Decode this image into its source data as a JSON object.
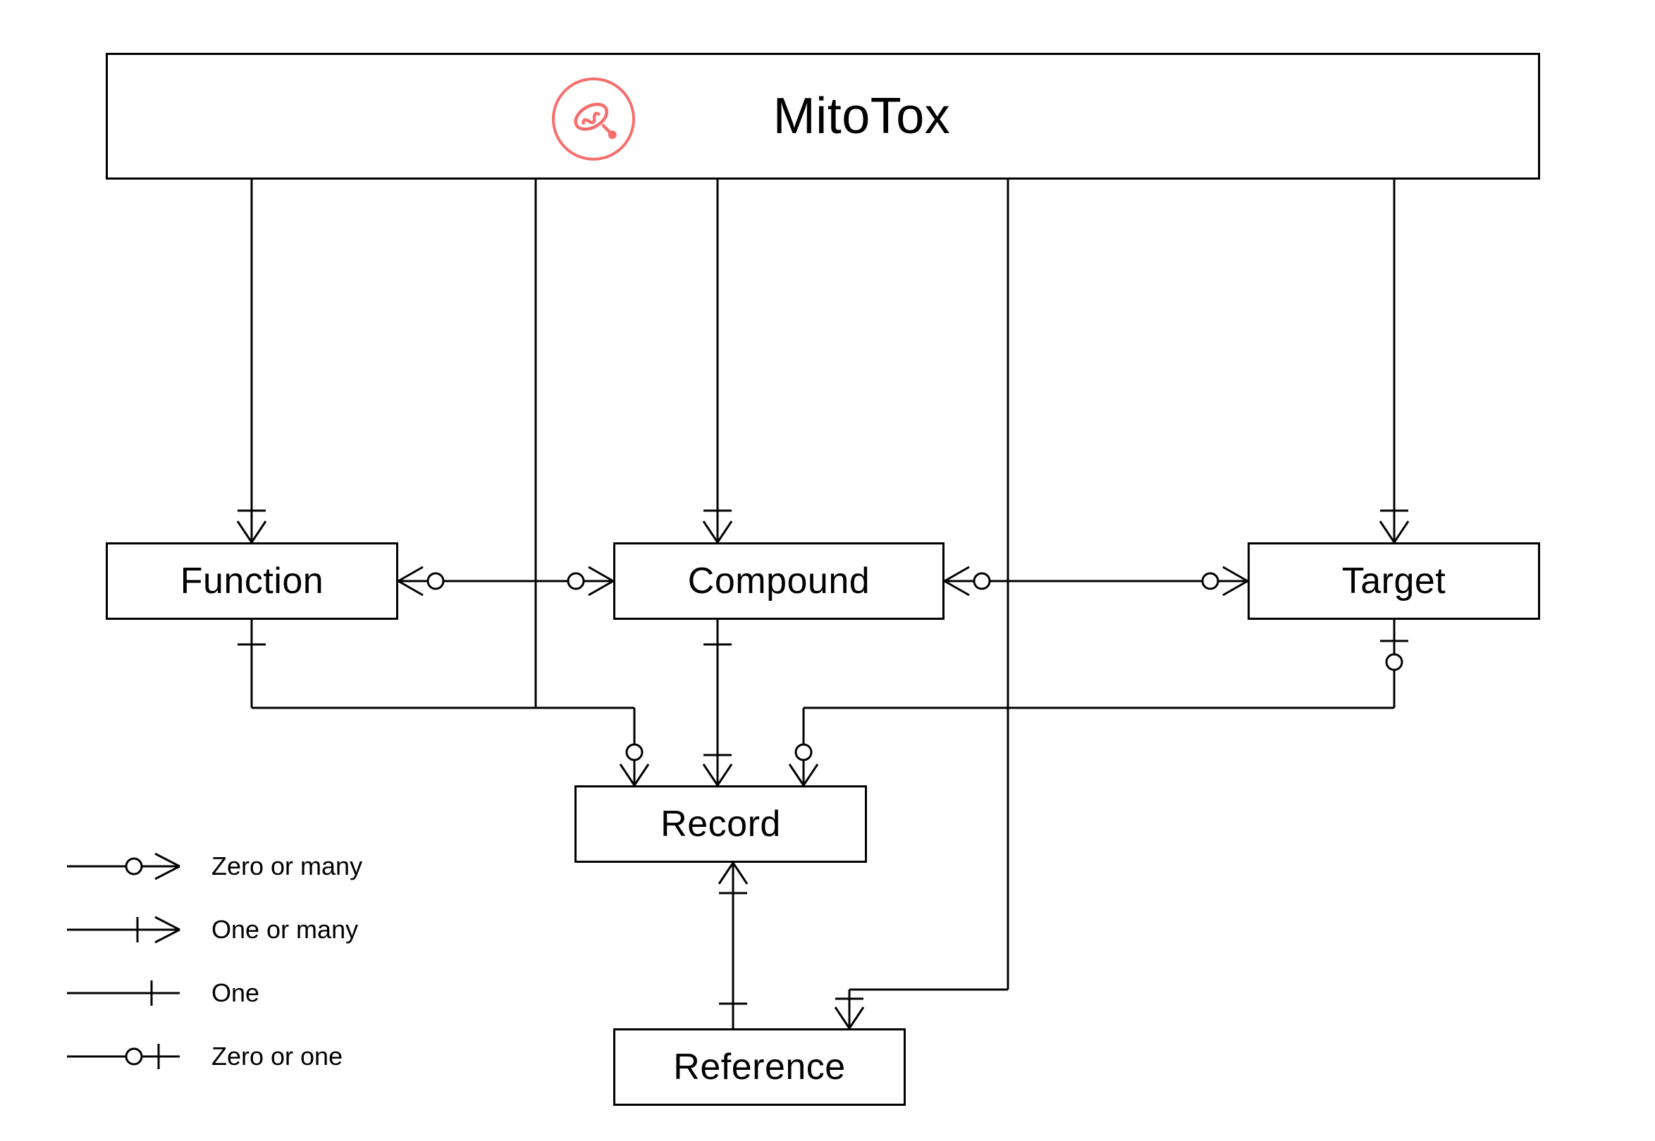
{
  "diagram": {
    "title": "MitoTox",
    "logo_name": "mitochondrion-icon",
    "accent_color": "#f76e6e",
    "entities": {
      "function": "Function",
      "compound": "Compound",
      "target": "Target",
      "record": "Record",
      "reference": "Reference"
    },
    "legend": {
      "zero_or_many": "Zero or many",
      "one_or_many": "One or many",
      "one": "One",
      "zero_or_one": "Zero or one"
    },
    "relationships": [
      {
        "from": "MitoTox",
        "to": "Function",
        "to_card": "one_or_many"
      },
      {
        "from": "MitoTox",
        "to": "Compound",
        "to_card": "one_or_many"
      },
      {
        "from": "MitoTox",
        "to": "Target",
        "to_card": "one_or_many"
      },
      {
        "from": "MitoTox",
        "to": "Reference",
        "to_card": "one_or_many"
      },
      {
        "from": "Function",
        "to": "Compound",
        "from_card": "zero_or_many",
        "to_card": "zero_or_many"
      },
      {
        "from": "Compound",
        "to": "Target",
        "from_card": "zero_or_many",
        "to_card": "zero_or_many"
      },
      {
        "from": "Function",
        "to": "Record",
        "from_card": "one",
        "to_card": "zero_or_many"
      },
      {
        "from": "Compound",
        "to": "Record",
        "from_card": "one",
        "to_card": "one_or_many"
      },
      {
        "from": "Target",
        "to": "Record",
        "from_card": "zero_or_one",
        "to_card": "zero_or_many"
      },
      {
        "from": "Record",
        "to": "Reference",
        "from_card": "one_or_many",
        "to_card": "one"
      }
    ]
  }
}
